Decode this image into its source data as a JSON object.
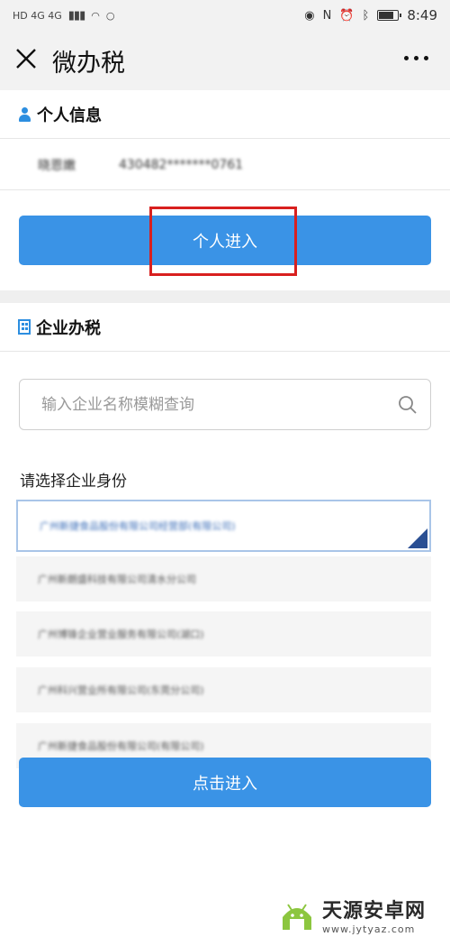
{
  "status_bar": {
    "left_text": "HD 4G 4G",
    "time": "8:49"
  },
  "nav": {
    "title": "微办税"
  },
  "personal": {
    "section_title": "个人信息",
    "id_label": "晓恩嫩",
    "id_value": "430482*******0761",
    "enter_button": "个人进入"
  },
  "enterprise": {
    "section_title": "企业办税",
    "search_placeholder": "输入企业名称模糊查询",
    "choose_label": "请选择企业身份",
    "companies": [
      "广州新捷食品股份有限公司经营部(有限公司)",
      "广州新朗盛科技有限公司清水分公司",
      "广州博锋企业营业服务有限公司(湖口)",
      "广州科兴营业所有限公司(东莞分公司)",
      "广州新捷食品股份有限公司(有限公司)"
    ],
    "enter_button": "点击进入"
  },
  "watermark": {
    "name": "天源安卓网",
    "url": "www.jytyaz.com"
  },
  "colors": {
    "primary": "#3a93e6",
    "highlight": "#d8201f",
    "icon_blue": "#2c8ee0"
  }
}
